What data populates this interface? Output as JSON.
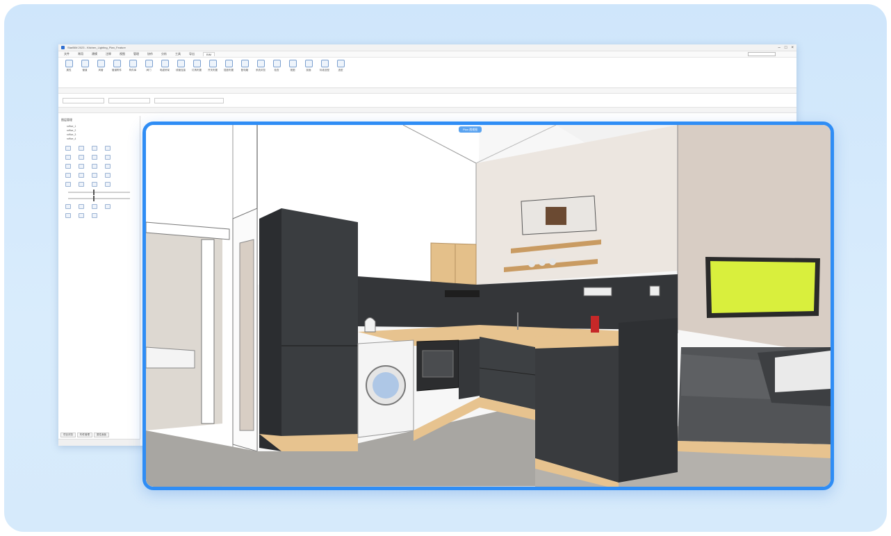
{
  "app": {
    "title": "StarBIM 2023 - Kitchen_Lighting_Plan_Feature",
    "tabs": [
      "文件",
      "常用",
      "建模",
      "注释",
      "视图",
      "管理",
      "协作",
      "分析",
      "工具",
      "导出",
      "BIM"
    ],
    "active_tab": "BIM",
    "ribbon_groups": [
      "属性",
      "管道",
      "风管",
      "管道附件",
      "电气",
      "设备",
      "照明",
      "分析",
      "视图",
      "标准选型"
    ],
    "ribbon_tools": [
      "属性",
      "管道",
      "风管",
      "管道附件",
      "构件库",
      "阀门",
      "电缆桥架",
      "线管连接",
      "灯具布置",
      "开关布置",
      "插座布置",
      "配电箱",
      "系统浏览",
      "检查",
      "视图",
      "剖面",
      "标准选型",
      "选型"
    ],
    "side_panel": {
      "header": "图层管理",
      "tree_items": [
        "roffice_1",
        "roffice_2",
        "roffice_3",
        "roffice_4"
      ],
      "tabs": [
        "项目浏览",
        "构件管理",
        "属性面板"
      ]
    },
    "view_tab": "Plan 透视图"
  },
  "colors": {
    "frame_accent": "#2f8df5",
    "card_bg": "#d6eafb",
    "cabinet": "#3a3d40",
    "wood": "#e7c38f",
    "tv_screen": "#d9ef3d",
    "wall_right": "#d8cdc4",
    "floor": "#a8a6a2"
  }
}
